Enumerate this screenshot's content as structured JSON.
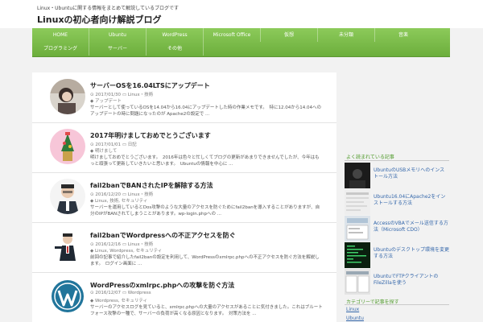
{
  "header": {
    "tagline": "Linux・Ubuntuに関する情報をまとめて解説しているブログです",
    "site_title": "Linuxの初心者向け解説ブログ"
  },
  "nav": {
    "row1": [
      "HOME",
      "Ubuntu",
      "WordPress",
      "Microsoft Office",
      "仮想",
      "未分類",
      "音楽"
    ],
    "row2": [
      "プログラミング",
      "サーバー",
      "その他"
    ]
  },
  "posts": [
    {
      "title": "サーバーOSを16.04LTSにアップデート",
      "date": "2017/01/30",
      "category": "Linux・技術",
      "tags": "アップデート",
      "excerpt": "サーバーとして使っているOSを14.04から16.04にアップデートした時の作業メモです。　特に12.04から14.04へのアップデートの時に問題になったのが Apache2の設定で ..."
    },
    {
      "title": "2017年明けましておめでとうございます",
      "date": "2017/01/01",
      "category": "日記",
      "tags": "明けまして",
      "excerpt": "明けましておめでとうございます。　2016年は色々と忙しくてブログの更新があまりできませんでしたが、今年はもっと頑張って更新していきたいと思います。　Ubuntuの情報を中心に ..."
    },
    {
      "title": "fail2banでBANされたIPを解除する方法",
      "date": "2016/12/20",
      "category": "Linux・技術",
      "tags": "Linux, 技術, セキュリティ",
      "excerpt": "サーバーを運用しているとDos攻撃のような大量のアクセスを防ぐためにfail2banを導入することがありますが、自分のIPがBANされてしまうことがあります。wp-login.phpへの ..."
    },
    {
      "title": "fail2banでWordpressへの不正アクセスを防ぐ",
      "date": "2016/12/16",
      "category": "Linux・技術",
      "tags": "Linux, Wordpress, セキュリティ",
      "excerpt": "前回の記事で紹介したfail2banの設定を利用して、WordPressのxmlrpc.phpへの不正アクセスを防ぐ方法を解説します。　ログイン画面に ..."
    },
    {
      "title": "WordPressのxmlrpc.phpへの攻撃を防ぐ方法",
      "date": "2016/12/07",
      "category": "Wordpress",
      "tags": "Wordpress, セキュリティ",
      "excerpt": "サーバーのアクセスログを見ていると、xmlrpc.phpへの大量のアクセスがあることに気付きました。これはブルートフォース攻撃の一種で、サーバーの負荷が高くなる原因となります。　対策方法を ..."
    }
  ],
  "sidebar": {
    "widget1_title": "よく読まれている記事",
    "popular": [
      "UbuntuのUSBメモリへのインストール方法",
      "Ubuntu16.04にApache2をインストールする方法",
      "AccessのVBAでメール送信する方法（Microsoft CDO）",
      "Ubuntuのデスクトップ環境を変更する方法",
      "UbuntuでFTPクライアントのFileZillaを使う"
    ],
    "widget2_title": "カテゴリーで記事を探す",
    "category_links": [
      "Linux",
      "Ubuntu"
    ]
  },
  "colors": {
    "nav_green": "#7cbc4a",
    "link_blue": "#3366aa",
    "widget_title_green": "#4f9a2a"
  }
}
